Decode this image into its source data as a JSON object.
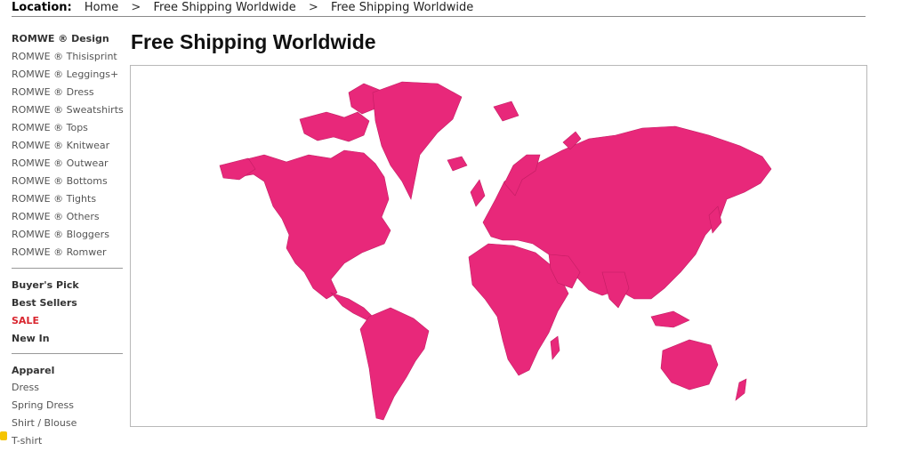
{
  "breadcrumb": {
    "label": "Location:",
    "items": [
      "Home",
      "Free Shipping Worldwide",
      "Free Shipping Worldwide"
    ],
    "separator": ">"
  },
  "page_title": "Free Shipping Worldwide",
  "sidebar": {
    "categories": [
      "ROMWE ® Design",
      "ROMWE ® Thisisprint",
      "ROMWE ® Leggings+",
      "ROMWE ® Dress",
      "ROMWE ® Sweatshirts",
      "ROMWE ® Tops",
      "ROMWE ® Knitwear",
      "ROMWE ® Outwear",
      "ROMWE ® Bottoms",
      "ROMWE ® Tights",
      "ROMWE ® Others",
      "ROMWE ® Bloggers",
      "ROMWE ® Romwer"
    ],
    "featured": [
      "Buyer's Pick",
      "Best Sellers",
      "SALE",
      "New In"
    ],
    "apparel_heading": "Apparel",
    "apparel_items": [
      "Dress",
      "Spring Dress",
      "Shirt / Blouse",
      "T-shirt"
    ]
  },
  "map": {
    "fill_color": "#e8287a",
    "border_color": "#b8b8b8"
  },
  "colors": {
    "sale": "#d9262f",
    "map_pink": "#e8287a"
  }
}
